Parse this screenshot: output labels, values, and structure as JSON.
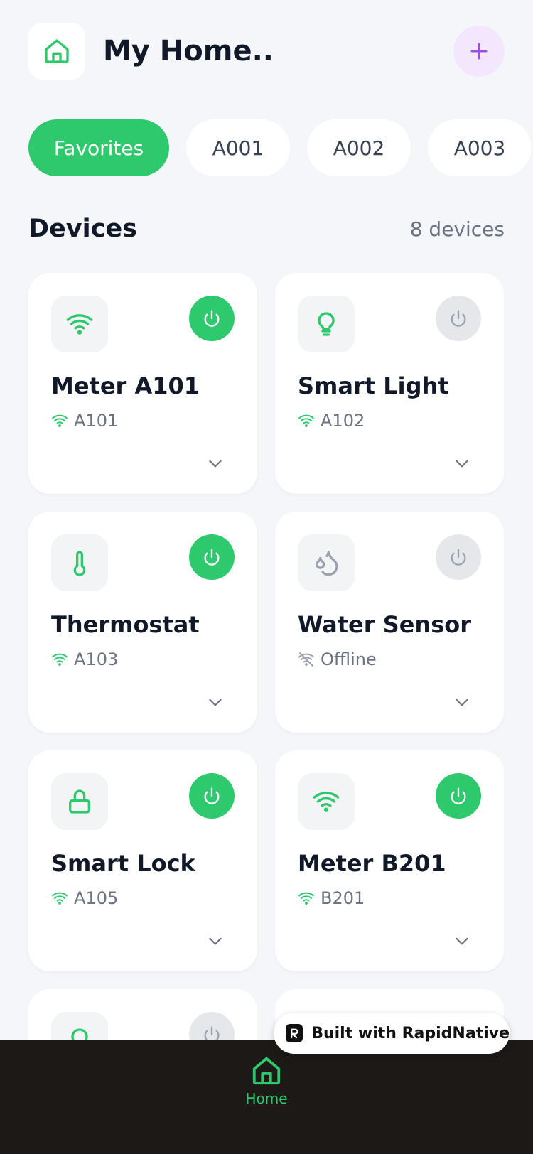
{
  "header": {
    "title": "My Home.."
  },
  "chips": [
    {
      "label": "Favorites",
      "active": true
    },
    {
      "label": "A001",
      "active": false
    },
    {
      "label": "A002",
      "active": false
    },
    {
      "label": "A003",
      "active": false
    }
  ],
  "devices": {
    "title": "Devices",
    "count": "8 devices",
    "items": [
      {
        "name": "Meter A101",
        "status": "A101",
        "icon": "wifi-icon",
        "on": true
      },
      {
        "name": "Smart Light",
        "status": "A102",
        "icon": "bulb-icon",
        "on": false
      },
      {
        "name": "Thermostat",
        "status": "A103",
        "icon": "thermometer-icon",
        "on": true
      },
      {
        "name": "Water Sensor",
        "status": "Offline",
        "icon": "droplets-icon",
        "on": false
      },
      {
        "name": "Smart Lock",
        "status": "A105",
        "icon": "lock-icon",
        "on": true
      },
      {
        "name": "Meter B201",
        "status": "B201",
        "icon": "wifi-icon",
        "on": true
      }
    ]
  },
  "badge": {
    "text": "Built with RapidNative"
  },
  "tabbar": {
    "home_label": "Home"
  },
  "colors": {
    "accent": "#2DC96C",
    "background": "#F5F6FA",
    "purple": "#9B51E0",
    "tabbar": "#1C1917"
  }
}
